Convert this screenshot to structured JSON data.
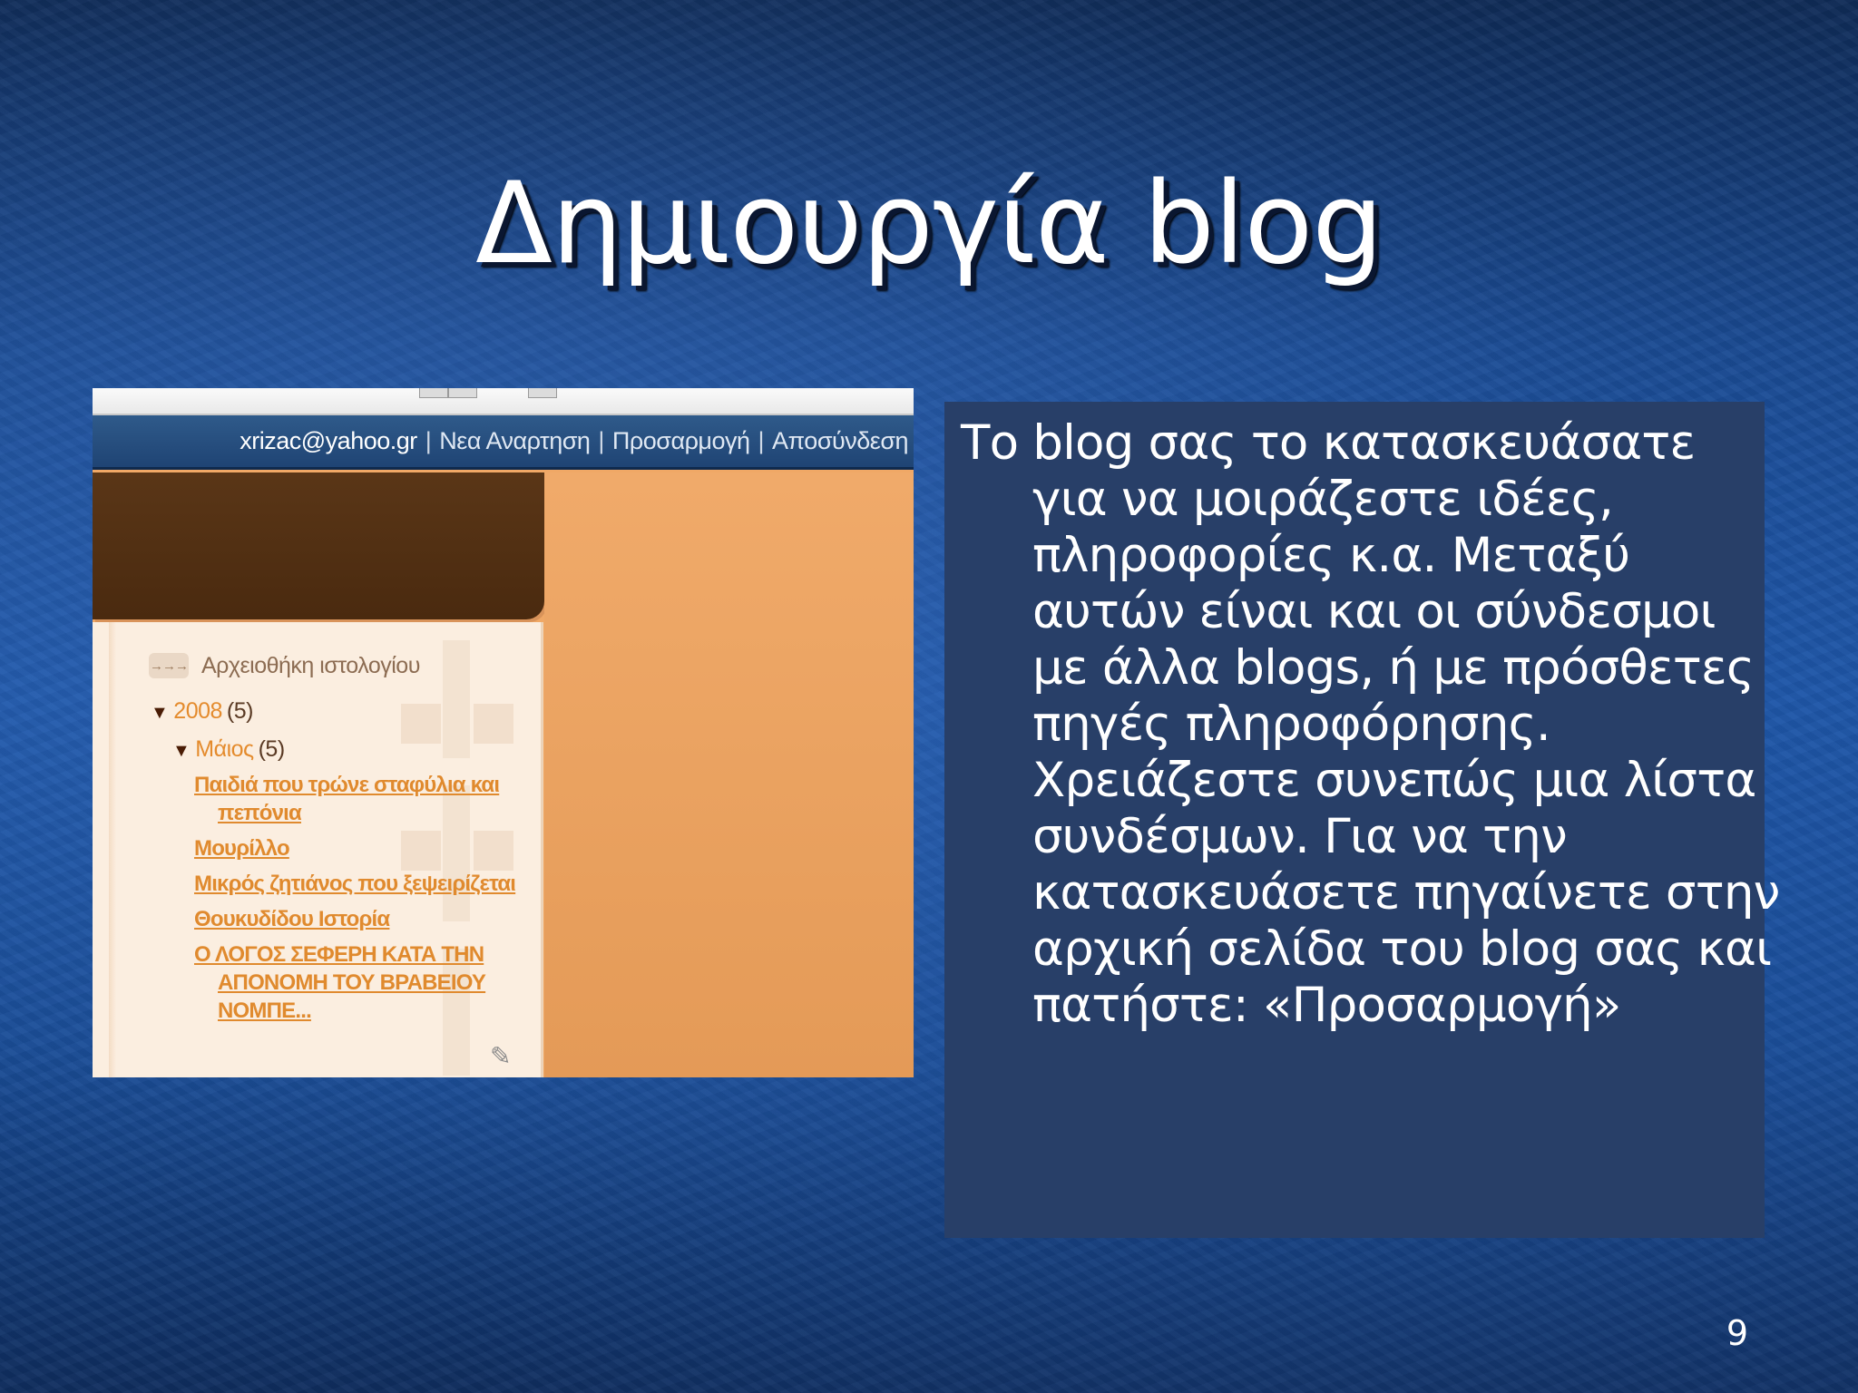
{
  "slide": {
    "title": "Δημιουργία blog",
    "number": "9"
  },
  "screenshot": {
    "nav": {
      "email": "xrizac@yahoo.gr",
      "separator": "|",
      "links": [
        "Νεα Αναρτηση",
        "Προσαρμογή",
        "Αποσύνδεση"
      ]
    },
    "archive": {
      "icon": "→→→",
      "heading": "Αρχειοθήκη ιστολογίου",
      "year": {
        "label": "2008",
        "count": "(5)"
      },
      "month": {
        "label": "Μάιος",
        "count": "(5)"
      },
      "posts": [
        {
          "line1": "Παιδιά που τρώνε σταφύλια και",
          "line2": "πεπόνια"
        },
        {
          "line1": "Μουρίλλο",
          "line2": ""
        },
        {
          "line1": "Μικρός ζητιάνος που ξεψειρίζεται",
          "line2": ""
        },
        {
          "line1": "Θουκυδίδου Ιστορία",
          "line2": ""
        },
        {
          "line1": "Ο ΛΟΓΟΣ ΣΕΦΕΡΗ ΚΑΤΑ ΤΗΝ",
          "line2": "ΑΠΟΝΟΜΗ ΤΟΥ ΒΡΑΒΕΙΟΥ",
          "line3": "ΝΟΜΠΕ..."
        }
      ],
      "tree_icon": "▼"
    }
  },
  "textbox": {
    "lines": [
      "Το blog σας το κατασκευάσατε",
      "για να μοιράζεστε ιδέες,",
      "πληροφορίες κ.α. Μεταξύ",
      "αυτών είναι και οι σύνδεσμοι",
      "με άλλα blogs, ή με πρόσθετες",
      "πηγές πληροφόρησης.",
      "Χρειάζεστε συνεπώς μια λίστα",
      "συνδέσμων. Για να την",
      "κατασκευάσετε πηγαίνετε στην",
      "αρχική σελίδα του blog σας και",
      "πατήστε: «Προσαρμογή»"
    ]
  },
  "colors": {
    "background": "#1d56a8",
    "textbox": "#283f68",
    "nav_bar": "#1f4474",
    "header_brown": "#4a2a0f",
    "orange": "#f0a866",
    "link_orange": "#e08a2e"
  }
}
